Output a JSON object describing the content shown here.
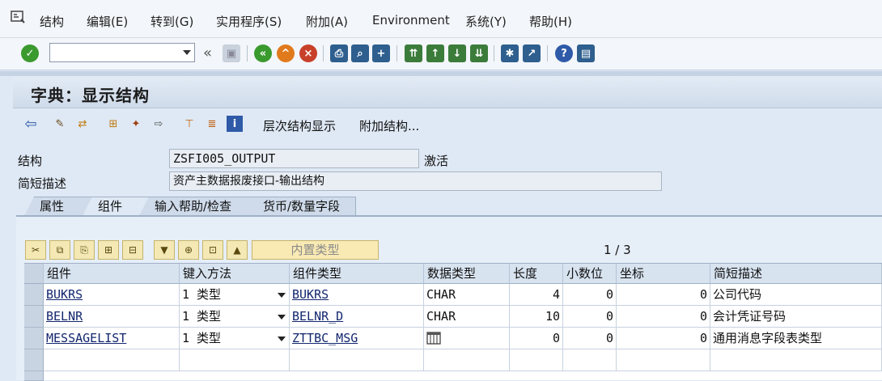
{
  "menubar": {
    "items": [
      "结构",
      "编辑(E)",
      "转到(G)",
      "实用程序(S)",
      "附加(A)",
      "Environment",
      "系统(Y)",
      "帮助(H)"
    ]
  },
  "toolbar": {
    "command_value": "",
    "nav_back_label": "«"
  },
  "screen": {
    "title": "字典：显示结构"
  },
  "app_toolbar": {
    "hierarchy_label": "层次结构显示",
    "append_label": "附加结构..."
  },
  "header": {
    "structure_label": "结构",
    "structure_value": "ZSFI005_OUTPUT",
    "status": "激活",
    "desc_label": "简短描述",
    "desc_value": "资产主数据报废接口-输出结构"
  },
  "tabs": [
    "属性",
    "组件",
    "输入帮助/检查",
    "货币/数量字段"
  ],
  "grid_toolbar": {
    "builtin_type_label": "内置类型",
    "page_indicator": "1 / 3"
  },
  "table": {
    "columns": [
      "组件",
      "键入方法",
      "组件类型",
      "数据类型",
      "长度",
      "小数位",
      "坐标",
      "简短描述"
    ],
    "rows": [
      {
        "component": "BUKRS",
        "typing": "1 类型",
        "ctype": "BUKRS",
        "dtype": "CHAR",
        "length": "4",
        "decimals": "0",
        "coord": "0",
        "desc": "公司代码"
      },
      {
        "component": "BELNR",
        "typing": "1 类型",
        "ctype": "BELNR_D",
        "dtype": "CHAR",
        "length": "10",
        "decimals": "0",
        "coord": "0",
        "desc": "会计凭证号码"
      },
      {
        "component": "MESSAGELIST",
        "typing": "1 类型",
        "ctype": "ZTTBC_MSG",
        "dtype": "table-icon",
        "length": "0",
        "decimals": "0",
        "coord": "0",
        "desc": "通用消息字段表类型"
      }
    ]
  },
  "colors": {
    "accent_green": "#3a9a2e",
    "accent_orange": "#e07a1c",
    "accent_red": "#c8402a",
    "help_blue": "#2f5aa8"
  }
}
